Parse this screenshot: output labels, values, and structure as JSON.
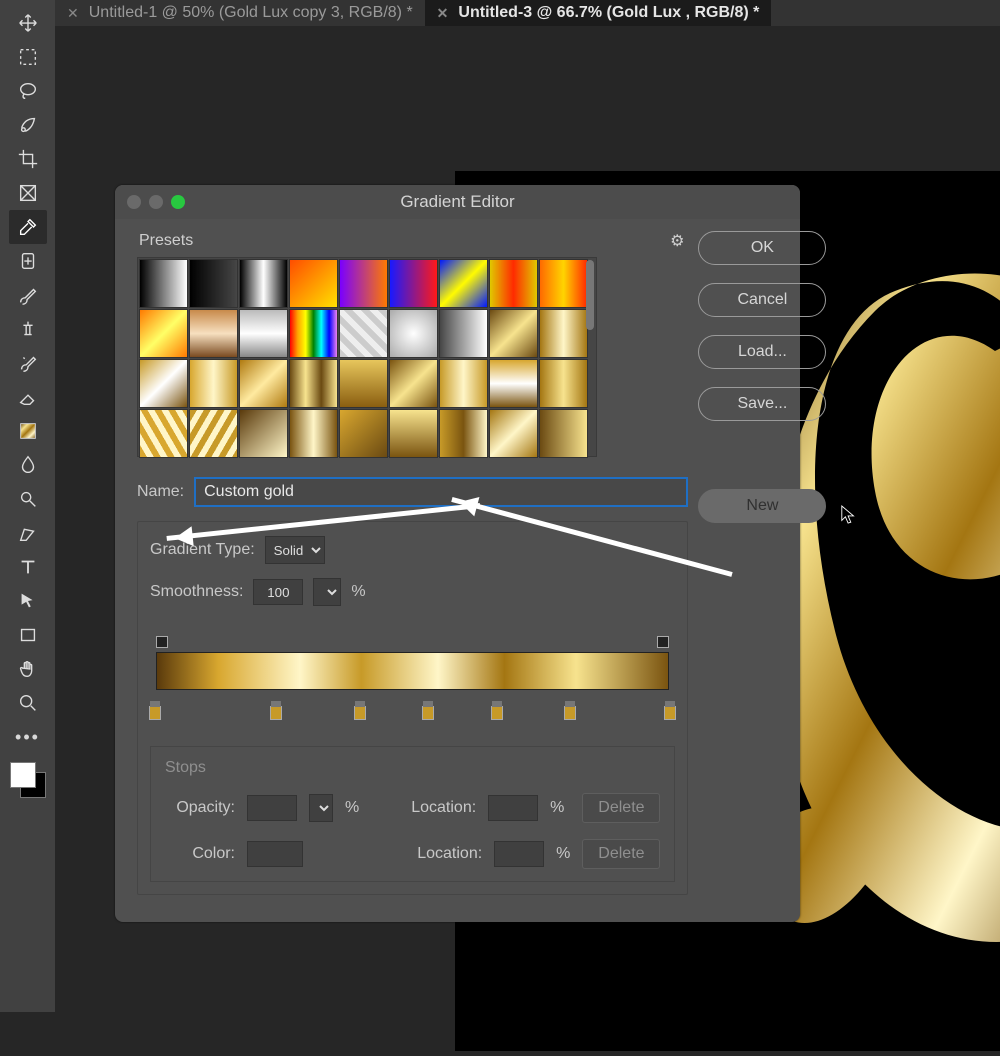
{
  "tabs": [
    {
      "label": "Untitled-1 @ 50% (Gold Lux copy 3, RGB/8) *",
      "active": false
    },
    {
      "label": "Untitled-3 @ 66.7% (Gold Lux , RGB/8) *",
      "active": true
    }
  ],
  "tools": [
    "move",
    "marquee",
    "lasso",
    "quick-select",
    "crop",
    "frame",
    "eyedropper",
    "healing",
    "brush",
    "stamp",
    "history-brush",
    "eraser",
    "gradient",
    "blur",
    "dodge",
    "pen",
    "type",
    "path-select",
    "rectangle",
    "hand",
    "zoom",
    "edit-toolbar",
    "more"
  ],
  "dialog": {
    "title": "Gradient Editor",
    "presets_label": "Presets",
    "buttons": {
      "ok": "OK",
      "cancel": "Cancel",
      "load": "Load...",
      "save": "Save...",
      "new": "New"
    },
    "name_label": "Name:",
    "name_value": "Custom gold",
    "gradient_type_label": "Gradient Type:",
    "gradient_type_value": "Solid",
    "smoothness_label": "Smoothness:",
    "smoothness_value": "100",
    "percent": "%",
    "stops": {
      "title": "Stops",
      "opacity": "Opacity:",
      "color": "Color:",
      "location": "Location:",
      "delete": "Delete"
    }
  },
  "presets_gradients": [
    "linear-gradient(to right,#000,#fff)",
    "linear-gradient(to right,#000,rgba(0,0,0,0))",
    "linear-gradient(to right,#000,#fff,#000)",
    "linear-gradient(135deg,#ff4d00,#ffe100)",
    "linear-gradient(to right,#7a00ff,#ff7a00)",
    "linear-gradient(to right,#1919ff,#ff1919)",
    "linear-gradient(135deg,#0019ff,#fffb00,#0019ff)",
    "linear-gradient(to right,#e0c800,#ff2a00,#e0c800)",
    "linear-gradient(to right,#ff6a00,#ffd400,#ff2a00)",
    "linear-gradient(135deg,#ff7a00,#ffff66,#ff7a00)",
    "linear-gradient(to bottom,#c88a4a,#f7e0c0,#7a4a20)",
    "linear-gradient(to bottom,#bbb,#fff,#888)",
    "linear-gradient(to right,red,orange,yellow,green,cyan,blue,violet)",
    "repeating-linear-gradient(45deg,#ccc 0 6px,#eee 6px 12px)",
    "radial-gradient(circle,#fff,#aaa)",
    "linear-gradient(to right,rgba(255,255,255,0),#fff)",
    "linear-gradient(135deg,#6b4a12,#f7e38e,#6b4a12)",
    "linear-gradient(to right,#a47612,#fff6c8,#a47612)",
    "linear-gradient(135deg,#c79a28,#fff,#7a5410)",
    "linear-gradient(to right,#d8a72f,#fff6c8,#c79a28)",
    "linear-gradient(135deg,#b07a10,#ffeaa0,#b07a10)",
    "linear-gradient(to right,#6b4a12,#f7e38e,#6b4a12,#f7e38e)",
    "linear-gradient(to bottom,#e7c65c,#8a5e10)",
    "linear-gradient(135deg,#7a5410,#f7e38e,#7a5410)",
    "linear-gradient(to right,#c79a28,#fff6c8,#c79a28)",
    "linear-gradient(to bottom,#d8a72f,#fff,#7a5410)",
    "linear-gradient(to right,#a47612,#f7e38e,#a47612)",
    "repeating-linear-gradient(60deg,#d8a72f 0 6px,#fff6c8 6px 12px)",
    "repeating-linear-gradient(120deg,#c79a28 0 6px,#fff6c8 6px 12px)",
    "linear-gradient(135deg,#5a3a0c,#fff6c8)",
    "linear-gradient(to right,#7a5410,#fff6c8,#7a5410)",
    "linear-gradient(135deg,#d8a72f,#6b4a12)",
    "linear-gradient(to bottom,#f7e38e,#7a5410)",
    "linear-gradient(to right,#c79a28,#7a5410,#fff6c8)",
    "linear-gradient(135deg,#a47612,#fff6c8,#a47612)",
    "linear-gradient(to right,#6b4a12,#f7e38e)"
  ],
  "color_stop_positions": [
    1,
    24,
    40,
    53,
    66,
    80,
    99
  ]
}
